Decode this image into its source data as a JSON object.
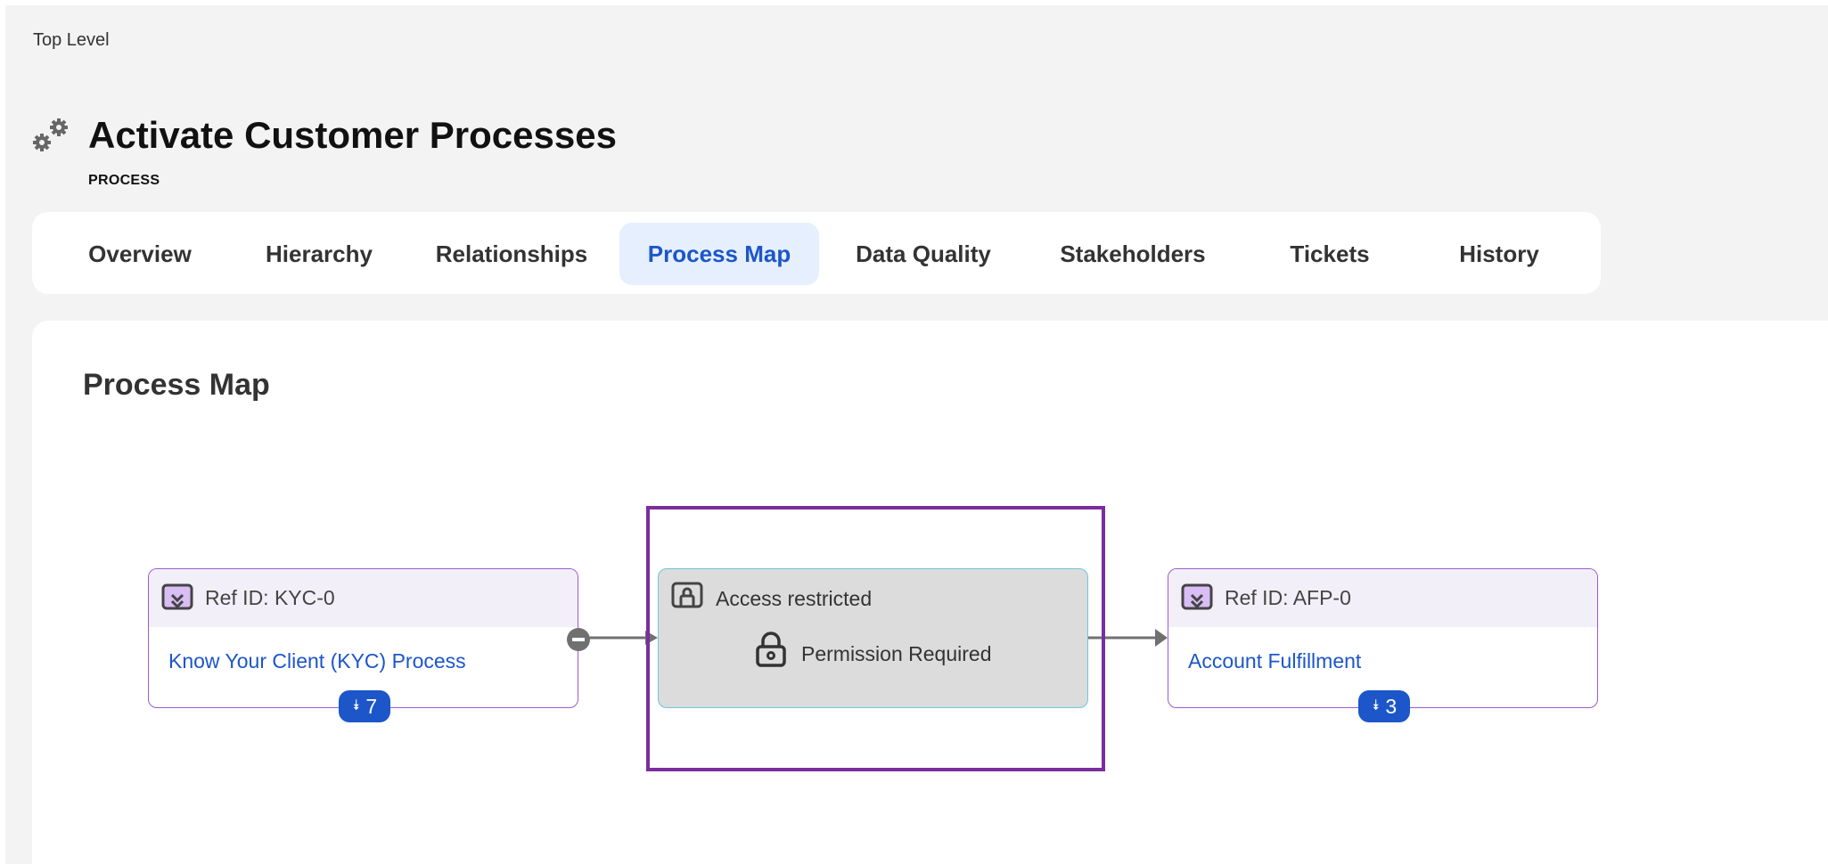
{
  "breadcrumb": "Top Level",
  "header": {
    "title": "Activate Customer Processes",
    "type_label": "PROCESS",
    "icon": "gears-icon"
  },
  "tabs": [
    {
      "label": "Overview",
      "active": false
    },
    {
      "label": "Hierarchy",
      "active": false
    },
    {
      "label": "Relationships",
      "active": false
    },
    {
      "label": "Process Map",
      "active": true
    },
    {
      "label": "Data Quality",
      "active": false
    },
    {
      "label": "Stakeholders",
      "active": false
    },
    {
      "label": "Tickets",
      "active": false
    },
    {
      "label": "History",
      "active": false
    }
  ],
  "section_title": "Process Map",
  "process_map": {
    "nodes": [
      {
        "ref": "Ref ID: KYC-0",
        "name": "Know Your Client (KYC) Process",
        "count": "7",
        "icon": "expand-subprocess-icon"
      },
      {
        "ref": "Ref ID: AFP-0",
        "name": "Account Fulfillment",
        "count": "3",
        "icon": "expand-subprocess-icon"
      }
    ],
    "restricted_node": {
      "label": "Access restricted",
      "message": "Permission Required",
      "icon": "restricted-screen-icon",
      "lock_icon": "lock-icon"
    }
  },
  "colors": {
    "accent": "#1c56c9",
    "active_tab_bg": "#e6effd",
    "node_border": "#9a5bcf",
    "node_header_bg": "#f3eff8",
    "restricted_bg": "#dcdcdd",
    "restricted_border": "#6cc6d8",
    "highlight": "#7b2d9e"
  }
}
